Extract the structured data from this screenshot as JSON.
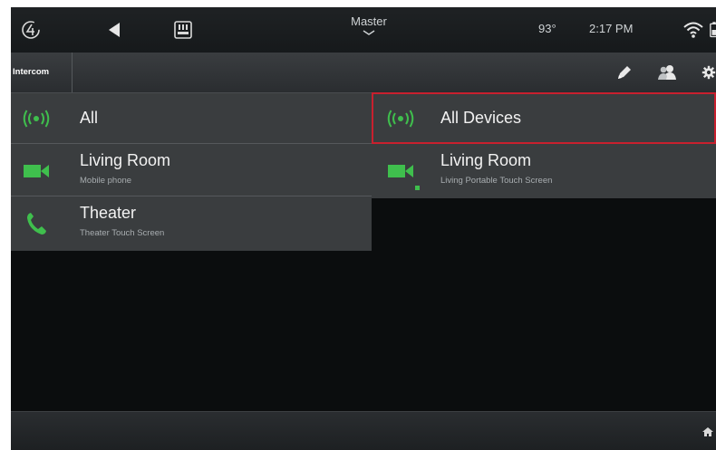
{
  "topbar": {
    "title": "Master",
    "temperature": "93°",
    "time": "2:17 PM",
    "icons": [
      "control4-logo-icon",
      "back-icon",
      "keypad-icon",
      "master-chevron-icon",
      "wifi-icon",
      "battery-icon"
    ]
  },
  "subbar": {
    "title": "Intercom",
    "icons": [
      "edit-icon",
      "contacts-icon",
      "settings-icon"
    ]
  },
  "left_list": [
    {
      "title": "All",
      "subtitle": "",
      "icon": "broadcast-icon"
    },
    {
      "title": "Living Room",
      "subtitle": "Mobile phone",
      "icon": "video-camera-icon"
    },
    {
      "title": "Theater",
      "subtitle": "Theater Touch Screen",
      "icon": "phone-icon"
    }
  ],
  "right_list": [
    {
      "title": "All Devices",
      "subtitle": "",
      "icon": "broadcast-icon",
      "selected": true
    },
    {
      "title": "Living Room",
      "subtitle": "Living Portable Touch Screen",
      "icon": "video-camera-icon",
      "online": true
    }
  ],
  "footer": {
    "icons": [
      "home-icon"
    ]
  },
  "colors": {
    "accent_green": "#3fbf4d",
    "selection_red": "#c8202e",
    "panel": "#3a3d3f",
    "background": "#0b0d0e"
  }
}
